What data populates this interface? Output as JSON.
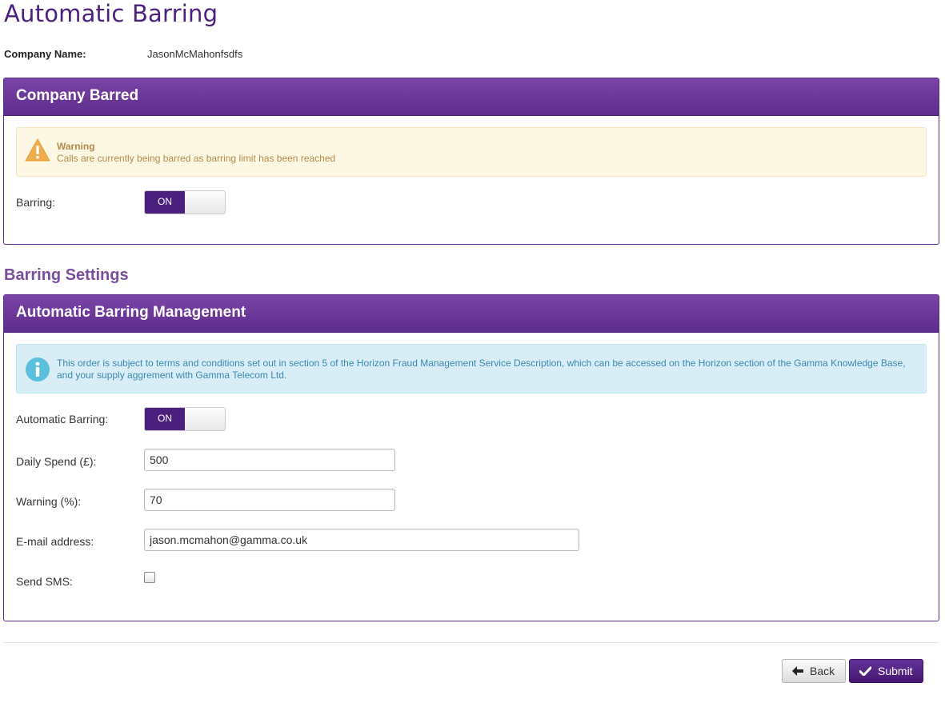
{
  "page": {
    "title": "Automatic Barring"
  },
  "company": {
    "label": "Company Name:",
    "value": "JasonMcMahonfsdfs"
  },
  "company_barred": {
    "heading": "Company Barred",
    "warning": {
      "icon": "warning-triangle-icon",
      "title": "Warning",
      "message": "Calls are currently being barred as barring limit has been reached"
    },
    "barring": {
      "label": "Barring:",
      "state": "ON"
    }
  },
  "settings": {
    "section_title": "Barring Settings",
    "heading": "Automatic Barring Management",
    "info": {
      "icon": "info-icon",
      "message": "This order is subject to terms and conditions set out in section 5 of the Horizon Fraud Management Service Description, which can be accessed on the Horizon section of the Gamma Knowledge Base, and your supply aggrement with Gamma Telecom Ltd."
    },
    "automatic_barring": {
      "label": "Automatic Barring:",
      "state": "ON"
    },
    "daily_spend": {
      "label": "Daily Spend (£):",
      "value": "500"
    },
    "warning_pct": {
      "label": "Warning (%):",
      "value": "70"
    },
    "email": {
      "label": "E-mail address:",
      "value": "jason.mcmahon@gamma.co.uk"
    },
    "send_sms": {
      "label": "Send SMS:",
      "checked": false
    }
  },
  "actions": {
    "back_label": "Back",
    "submit_label": "Submit"
  },
  "colors": {
    "brand": "#4b1f7e",
    "panel_header": "#6a3798",
    "warning_bg": "#fcf8e3",
    "info_bg": "#d9edf7"
  }
}
